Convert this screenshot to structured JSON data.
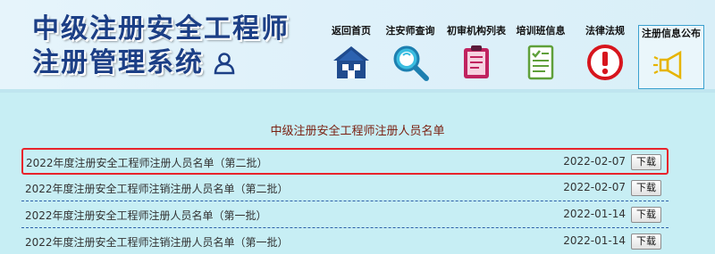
{
  "header": {
    "title_line1": "中级注册安全工程师",
    "title_line2": "注册管理系统"
  },
  "nav": {
    "items": [
      {
        "label": "返回首页",
        "icon": "home-icon"
      },
      {
        "label": "注安师查询",
        "icon": "magnifier-icon"
      },
      {
        "label": "初审机构列表",
        "icon": "clipboard-icon"
      },
      {
        "label": "培训班信息",
        "icon": "document-check-icon"
      },
      {
        "label": "法律法规",
        "icon": "exclamation-icon"
      },
      {
        "label": "注册信息公布",
        "icon": "megaphone-icon"
      }
    ],
    "active_index": 5
  },
  "main": {
    "title": "中级注册安全工程师注册人员名单",
    "download_label": "下载",
    "rows": [
      {
        "name": "2022年度注册安全工程师注册人员名单（第二批）",
        "date": "2022-02-07",
        "highlighted": true
      },
      {
        "name": "2022年度注册安全工程师注销注册人员名单（第二批）",
        "date": "2022-02-07",
        "highlighted": false
      },
      {
        "name": "2022年度注册安全工程师注册人员名单（第一批）",
        "date": "2022-01-14",
        "highlighted": false
      },
      {
        "name": "2022年度注册安全工程师注销注册人员名单（第一批）",
        "date": "2022-01-14",
        "highlighted": false
      }
    ]
  },
  "colors": {
    "page_bg": "#c7eef4",
    "logo_text": "#1c3f86",
    "title_text": "#7a1f10",
    "highlight_border": "#e8232b",
    "row_divider": "#2b5fa8"
  }
}
